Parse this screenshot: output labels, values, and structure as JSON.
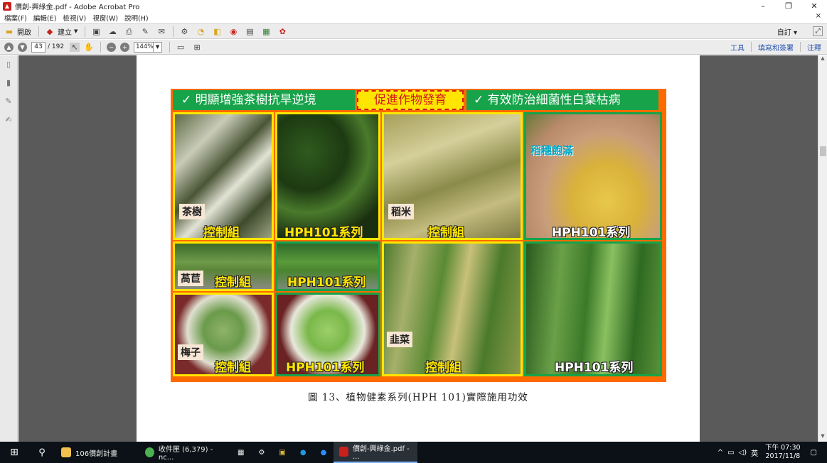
{
  "window": {
    "title": "價創-興綠金.pdf - Adobe Acrobat Pro",
    "controls": [
      "–",
      "❐",
      "✕"
    ]
  },
  "menu": {
    "items": [
      "檔案(F)",
      "編輯(E)",
      "檢視(V)",
      "視窗(W)",
      "說明(H)"
    ],
    "close_doc": "×"
  },
  "toolbar": {
    "open_label": "開啟",
    "create_label": "建立",
    "customize_label": "自訂"
  },
  "nav": {
    "page_number": "43",
    "page_total": "/ 192",
    "zoom": "144%"
  },
  "right_links": [
    "工具",
    "填寫和簽署",
    "注釋"
  ],
  "figure": {
    "banner_left": "✓ 明顯增強茶樹抗旱逆境",
    "banner_mid": "促進作物發育",
    "banner_right": "✓ 有效防治細菌性白葉枯病",
    "tiles": {
      "tea_label": "茶樹",
      "tea_control": "控制組",
      "tea_hph": "HPH101系列",
      "rice_label": "稻米",
      "rice_control": "控制組",
      "rice_full": "稻穗飽滿",
      "rice_hph": "HPH101系列",
      "lettuce_label": "萵苣",
      "lettuce_control": "控制組",
      "lettuce_hph": "HPH101系列",
      "plum_label": "梅子",
      "plum_control": "控制組",
      "plum_hph": "HPH101系列",
      "chive_label": "韭菜",
      "chive_control": "控制組",
      "chive_hph": "HPH101系列"
    },
    "caption": "圖 13、植物健素系列(HPH 101)實際施用功效"
  },
  "taskbar": {
    "items": [
      {
        "label": "106價創計畫",
        "color": "#f2c14e"
      },
      {
        "label": "收件匣 (6,379) - nc...",
        "color": "#4caf50"
      },
      {
        "label": "價創-興綠金.pdf - ...",
        "color": "#c8211b"
      }
    ],
    "tray_text": "英",
    "time": "下午 07:30",
    "date": "2017/11/8"
  }
}
